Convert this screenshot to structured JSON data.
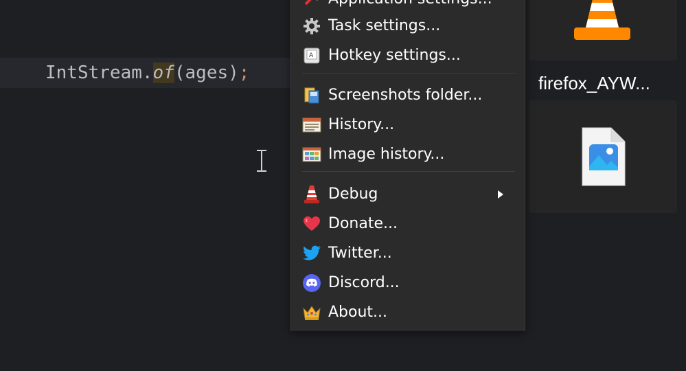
{
  "editor": {
    "code": {
      "class_name": "IntStream",
      "dot": ".",
      "method": "of",
      "args": "(ages)",
      "terminator": ";"
    }
  },
  "context_menu": {
    "items": [
      {
        "label": "Application settings...",
        "icon": "settings-app-icon"
      },
      {
        "label": "Task settings...",
        "icon": "gear-icon"
      },
      {
        "label": "Hotkey settings...",
        "icon": "keyboard-key-icon"
      },
      {
        "label": "Screenshots folder...",
        "icon": "folder-icon"
      },
      {
        "label": "History...",
        "icon": "history-window-icon"
      },
      {
        "label": "Image history...",
        "icon": "image-history-icon"
      },
      {
        "label": "Debug",
        "icon": "traffic-cone-icon",
        "has_submenu": true
      },
      {
        "label": "Donate...",
        "icon": "heart-icon"
      },
      {
        "label": "Twitter...",
        "icon": "twitter-bird-icon"
      },
      {
        "label": "Discord...",
        "icon": "discord-icon"
      },
      {
        "label": "About...",
        "icon": "crown-icon"
      }
    ]
  },
  "desktop": {
    "file_caption": "firefox_AYW...",
    "file_icon": "image-file-icon",
    "app_icon": "vlc-cone-icon"
  },
  "colors": {
    "editor_bg": "#1e1f22",
    "menu_bg": "#2b2b2b",
    "accent_semicolon": "#cf8e6d",
    "method_highlight": "#43391e"
  }
}
